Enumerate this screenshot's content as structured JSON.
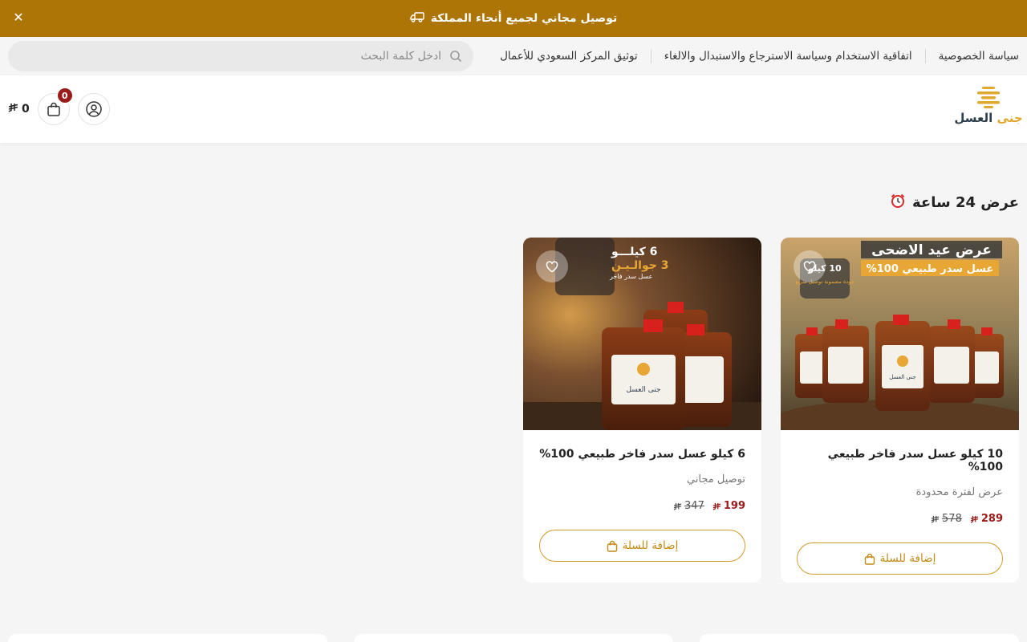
{
  "announcement": {
    "text": "توصيل مجاني لجميع أنحاء المملكة",
    "close_icon": "close-icon",
    "icon": "delivery-truck-icon"
  },
  "top_links": [
    "سياسة الخصوصية",
    "اتفاقية الاستخدام وسياسة الاسترجاع والاستبدال والالغاء",
    "توثيق المركز السعودي للأعمال"
  ],
  "search": {
    "placeholder": "ادخل كلمة البحث",
    "value": ""
  },
  "logo": {
    "name": "جنى العسل",
    "accent": "جنى",
    "rest": "العسل"
  },
  "cart": {
    "count": "0",
    "total": "0"
  },
  "section": {
    "title": "عرض 24 ساعة",
    "icon": "alarm-clock-icon"
  },
  "products": [
    {
      "title": "10 كيلو عسل سدر فاخر طبيعي 100%",
      "subtitle": "عرض لفترة محدودة",
      "price": "289",
      "old_price": "578",
      "button": "إضافة للسلة",
      "image_banner_top": "عرض عيد الاضحى",
      "image_banner_bottom": "عسل سدر طبيعي 100%",
      "image_badge": "10 كيلو",
      "image_badge_sub": "جودة مضمونة توصيل سريع",
      "jar_label": "جنى العسل"
    },
    {
      "title": "6 كيلو عسل سدر فاخر طبيعي 100%",
      "subtitle": "توصيل مجاني",
      "price": "199",
      "old_price": "347",
      "button": "إضافة للسلة",
      "image_text_1": "6 كيلـــو",
      "image_text_2": "3 جوالـيـن",
      "image_text_3": "عسل سدر فاخر",
      "jar_label": "جنى العسل"
    }
  ],
  "colors": {
    "brand": "#ad7506",
    "accent": "#e0a82e",
    "price": "#9b1b1b",
    "button_border": "#d29a2a"
  }
}
